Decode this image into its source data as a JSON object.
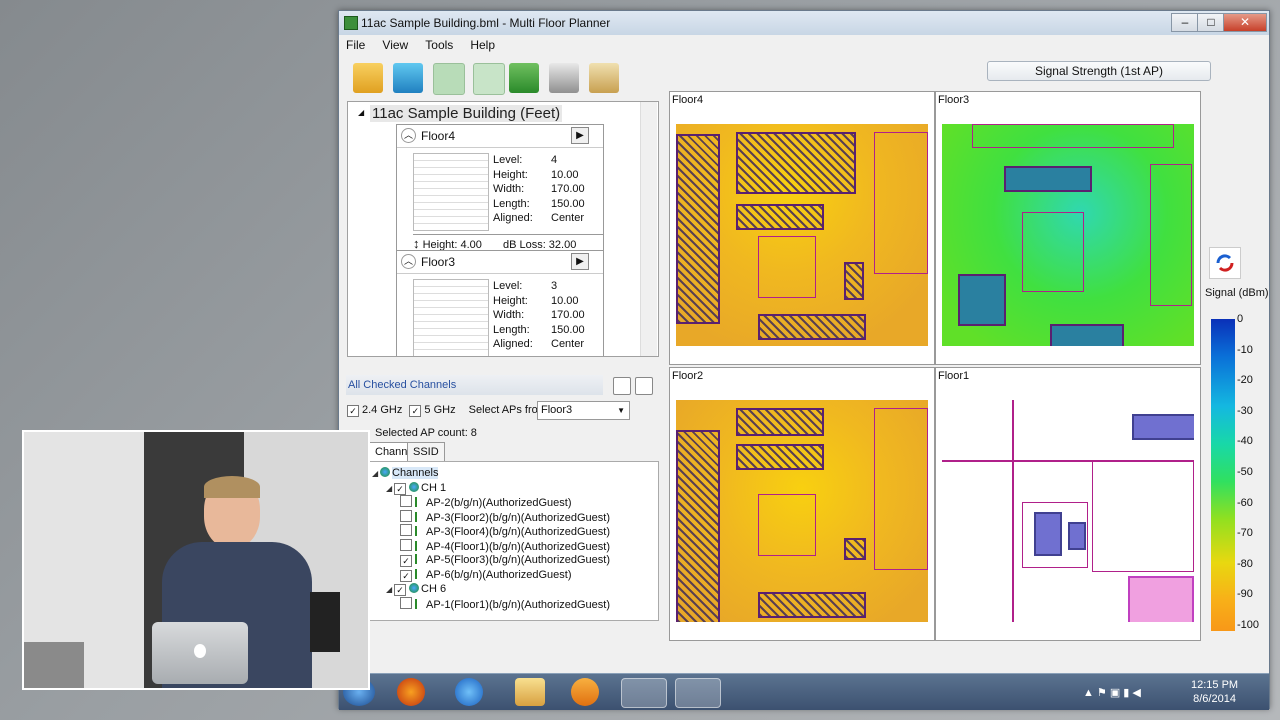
{
  "window": {
    "title": "11ac Sample Building.bml - Multi Floor Planner",
    "minimize": "–",
    "maximize": "□",
    "close": "✕"
  },
  "menu": [
    "File",
    "View",
    "Tools",
    "Help"
  ],
  "toolbar": {
    "icons": [
      "open-folder-icon",
      "3d-cube-icon",
      "floor-plan-icon",
      "grid-icon",
      "export-icon",
      "print-icon",
      "clipboard-icon"
    ],
    "signal_dropdown": "Signal Strength (1st AP)"
  },
  "building": {
    "name": "11ac Sample Building (Feet)",
    "floors": [
      {
        "name": "Floor4",
        "level": "4",
        "height": "10.00",
        "width": "170.00",
        "length": "150.00",
        "aligned": "Center",
        "gap_height": "Height: 4.00",
        "db_loss": "dB Loss: 32.00"
      },
      {
        "name": "Floor3",
        "level": "3",
        "height": "10.00",
        "width": "170.00",
        "length": "150.00",
        "aligned": "Center"
      }
    ],
    "labels": {
      "level": "Level:",
      "height": "Height:",
      "width": "Width:",
      "length": "Length:",
      "aligned": "Aligned:"
    }
  },
  "channels_panel": {
    "header": "All Checked Channels",
    "band_24": "2.4 GHz",
    "band_5": "5 GHz",
    "select_aps_label": "Select APs from:",
    "select_aps_value": "Floor3",
    "ap_count": "Selected AP count: 8",
    "tabs": [
      "Channels",
      "SSID"
    ],
    "tree": [
      {
        "indent": 0,
        "text": "Channels",
        "type": "root"
      },
      {
        "indent": 1,
        "text": "CH 1",
        "type": "channel",
        "checked": true
      },
      {
        "indent": 2,
        "text": "AP-2(b/g/n)(AuthorizedGuest)",
        "type": "ap",
        "checked": false
      },
      {
        "indent": 2,
        "text": "AP-3(Floor2)(b/g/n)(AuthorizedGuest)",
        "type": "ap",
        "checked": false
      },
      {
        "indent": 2,
        "text": "AP-3(Floor4)(b/g/n)(AuthorizedGuest)",
        "type": "ap",
        "checked": false
      },
      {
        "indent": 2,
        "text": "AP-4(Floor1)(b/g/n)(AuthorizedGuest)",
        "type": "ap",
        "checked": false
      },
      {
        "indent": 2,
        "text": "AP-5(Floor3)(b/g/n)(AuthorizedGuest)",
        "type": "ap",
        "checked": true
      },
      {
        "indent": 2,
        "text": "AP-6(b/g/n)(AuthorizedGuest)",
        "type": "ap",
        "checked": true
      },
      {
        "indent": 1,
        "text": "CH 6",
        "type": "channel",
        "checked": true
      },
      {
        "indent": 2,
        "text": "AP-1(Floor1)(b/g/n)(AuthorizedGuest)",
        "type": "ap",
        "checked": false
      }
    ]
  },
  "floor_views": [
    {
      "name": "Floor4",
      "colors": "#f0b820"
    },
    {
      "name": "Floor3",
      "colors": "#40e040"
    },
    {
      "name": "Floor2",
      "colors": "#f0b820"
    },
    {
      "name": "Floor1",
      "colors": "#ffffff"
    }
  ],
  "legend": {
    "title": "Signal (dBm)",
    "ticks": [
      "0",
      "-10",
      "-20",
      "-30",
      "-40",
      "-50",
      "-60",
      "-70",
      "-80",
      "-90",
      "-100"
    ]
  },
  "taskbar": {
    "icons": [
      "start-orb-icon",
      "firefox-icon",
      "ie-icon",
      "explorer-icon",
      "media-player-icon",
      "multi-floor-planner-icon",
      "spreadsheet-icon"
    ],
    "time": "12:15 PM",
    "date": "8/6/2014"
  }
}
